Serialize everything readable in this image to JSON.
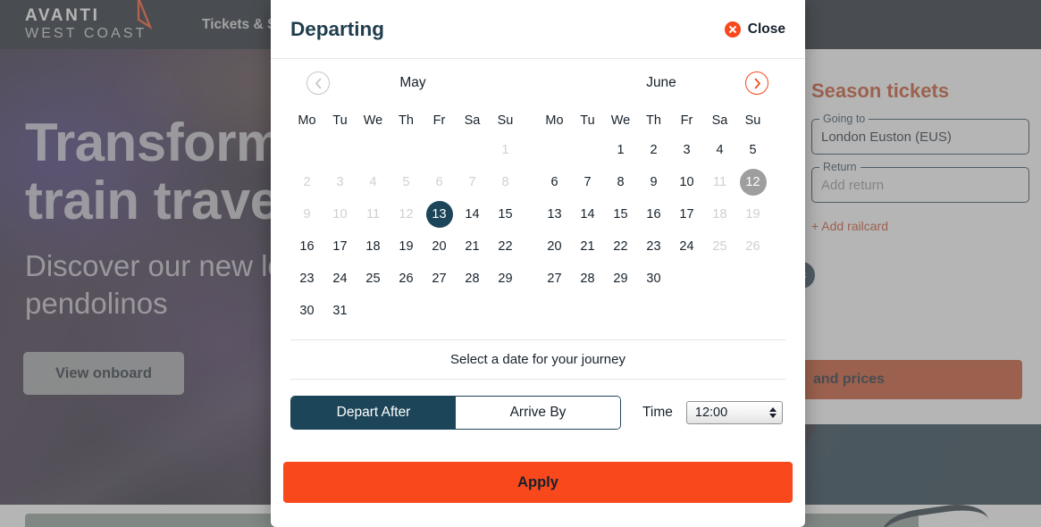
{
  "site": {
    "brand": {
      "line1": "AVANTI",
      "line2": "WEST COAST",
      "logo_icon": "triangle-logo-icon"
    },
    "nav": {
      "tickets_link": "Tickets & Savings"
    },
    "hero": {
      "title": "Transform\ntrain travel",
      "subtitle": "Discover our new look\npendolinos",
      "button": "View onboard"
    },
    "booking": {
      "title": "Season tickets",
      "going_to_legend": "Going to",
      "going_to_value": "London Euston (EUS)",
      "return_legend": "Return",
      "return_placeholder": "Add return",
      "railcard_link": "+ Add railcard",
      "cta": "and prices",
      "swap_icon": "swap-arrows-icon"
    }
  },
  "modal": {
    "title": "Departing",
    "close_label": "Close",
    "close_icon": "close-circle-icon",
    "prev_icon": "chevron-left-icon",
    "next_icon": "chevron-right-icon",
    "hint": "Select a date for your journey",
    "time_label": "Time",
    "time_value": "12:00",
    "apply_label": "Apply",
    "segmented": {
      "depart_after": "Depart After",
      "arrive_by": "Arrive By",
      "active": "Depart After"
    },
    "day_names": [
      "Mo",
      "Tu",
      "We",
      "Th",
      "Fr",
      "Sa",
      "Su"
    ],
    "months": [
      {
        "name": "May",
        "weeks": [
          [
            {
              "d": "",
              "state": "empty"
            },
            {
              "d": "",
              "state": "empty"
            },
            {
              "d": "",
              "state": "empty"
            },
            {
              "d": "",
              "state": "empty"
            },
            {
              "d": "",
              "state": "empty"
            },
            {
              "d": "",
              "state": "empty"
            },
            {
              "d": "1",
              "state": "muted"
            }
          ],
          [
            {
              "d": "2",
              "state": "muted"
            },
            {
              "d": "3",
              "state": "muted"
            },
            {
              "d": "4",
              "state": "muted"
            },
            {
              "d": "5",
              "state": "muted"
            },
            {
              "d": "6",
              "state": "muted"
            },
            {
              "d": "7",
              "state": "muted"
            },
            {
              "d": "8",
              "state": "muted"
            }
          ],
          [
            {
              "d": "9",
              "state": "muted"
            },
            {
              "d": "10",
              "state": "muted"
            },
            {
              "d": "11",
              "state": "muted"
            },
            {
              "d": "12",
              "state": "muted"
            },
            {
              "d": "13",
              "state": "selected"
            },
            {
              "d": "14",
              "state": "normal"
            },
            {
              "d": "15",
              "state": "normal"
            }
          ],
          [
            {
              "d": "16",
              "state": "normal"
            },
            {
              "d": "17",
              "state": "normal"
            },
            {
              "d": "18",
              "state": "normal"
            },
            {
              "d": "19",
              "state": "normal"
            },
            {
              "d": "20",
              "state": "normal"
            },
            {
              "d": "21",
              "state": "normal"
            },
            {
              "d": "22",
              "state": "normal"
            }
          ],
          [
            {
              "d": "23",
              "state": "normal"
            },
            {
              "d": "24",
              "state": "normal"
            },
            {
              "d": "25",
              "state": "normal"
            },
            {
              "d": "26",
              "state": "normal"
            },
            {
              "d": "27",
              "state": "normal"
            },
            {
              "d": "28",
              "state": "normal"
            },
            {
              "d": "29",
              "state": "normal"
            }
          ],
          [
            {
              "d": "30",
              "state": "normal"
            },
            {
              "d": "31",
              "state": "normal"
            },
            {
              "d": "",
              "state": "empty"
            },
            {
              "d": "",
              "state": "empty"
            },
            {
              "d": "",
              "state": "empty"
            },
            {
              "d": "",
              "state": "empty"
            },
            {
              "d": "",
              "state": "empty"
            }
          ]
        ]
      },
      {
        "name": "June",
        "weeks": [
          [
            {
              "d": "",
              "state": "empty"
            },
            {
              "d": "",
              "state": "empty"
            },
            {
              "d": "1",
              "state": "normal"
            },
            {
              "d": "2",
              "state": "normal"
            },
            {
              "d": "3",
              "state": "normal"
            },
            {
              "d": "4",
              "state": "normal"
            },
            {
              "d": "5",
              "state": "normal"
            }
          ],
          [
            {
              "d": "6",
              "state": "normal"
            },
            {
              "d": "7",
              "state": "normal"
            },
            {
              "d": "8",
              "state": "normal"
            },
            {
              "d": "9",
              "state": "normal"
            },
            {
              "d": "10",
              "state": "normal"
            },
            {
              "d": "11",
              "state": "muted"
            },
            {
              "d": "12",
              "state": "hover"
            }
          ],
          [
            {
              "d": "13",
              "state": "normal"
            },
            {
              "d": "14",
              "state": "normal"
            },
            {
              "d": "15",
              "state": "normal"
            },
            {
              "d": "16",
              "state": "normal"
            },
            {
              "d": "17",
              "state": "normal"
            },
            {
              "d": "18",
              "state": "muted"
            },
            {
              "d": "19",
              "state": "muted"
            }
          ],
          [
            {
              "d": "20",
              "state": "normal"
            },
            {
              "d": "21",
              "state": "normal"
            },
            {
              "d": "22",
              "state": "normal"
            },
            {
              "d": "23",
              "state": "normal"
            },
            {
              "d": "24",
              "state": "normal"
            },
            {
              "d": "25",
              "state": "muted"
            },
            {
              "d": "26",
              "state": "muted"
            }
          ],
          [
            {
              "d": "27",
              "state": "normal"
            },
            {
              "d": "28",
              "state": "normal"
            },
            {
              "d": "29",
              "state": "normal"
            },
            {
              "d": "30",
              "state": "normal"
            },
            {
              "d": "",
              "state": "empty"
            },
            {
              "d": "",
              "state": "empty"
            },
            {
              "d": "",
              "state": "empty"
            }
          ],
          [
            {
              "d": "",
              "state": "empty"
            },
            {
              "d": "",
              "state": "empty"
            },
            {
              "d": "",
              "state": "empty"
            },
            {
              "d": "",
              "state": "empty"
            },
            {
              "d": "",
              "state": "empty"
            },
            {
              "d": "",
              "state": "empty"
            },
            {
              "d": "",
              "state": "empty"
            }
          ]
        ]
      }
    ]
  },
  "colors": {
    "brand_dark": "#101820",
    "teal": "#1d4559",
    "orange": "#f8481c",
    "orange_dark": "#c5451c",
    "muted": "#cdd0d2",
    "hover_grey": "#9e9e9e"
  }
}
